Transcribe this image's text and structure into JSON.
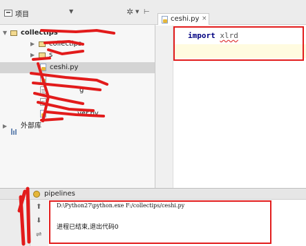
{
  "project_panel": {
    "title": "项目",
    "tree": [
      {
        "type": "folder",
        "label": "collectips",
        "expanded": true
      },
      {
        "type": "folder",
        "label": "collectips"
      },
      {
        "type": "folder",
        "label": "s"
      },
      {
        "type": "pyfile",
        "label": "ceshi.py",
        "selected": true
      },
      {
        "type": "pyfile",
        "label": ""
      },
      {
        "type": "txtfile",
        "label": "g"
      },
      {
        "type": "txtfile",
        "label": ""
      },
      {
        "type": "pyfile",
        "label": "ver.py"
      },
      {
        "type": "library",
        "label": "外部库"
      }
    ]
  },
  "editor": {
    "tab_label": "ceshi.py",
    "tab_close": "×",
    "code": {
      "keyword": "import",
      "module": "xlrd"
    }
  },
  "run_panel": {
    "title": "pipelines",
    "command": "D:\\Python27\\python.exe F:/collectips/ceshi.py",
    "exit_message": "进程已结束,退出代码0"
  },
  "icons": {
    "gear": "gear-icon",
    "collapse": "collapse-icon",
    "up": "up-arrow-icon",
    "down": "down-arrow-icon",
    "wrap": "wrap-icon"
  },
  "colors": {
    "annotation_red": "#e21b1b",
    "selection": "#d4d4d4",
    "keyword": "#000080"
  }
}
